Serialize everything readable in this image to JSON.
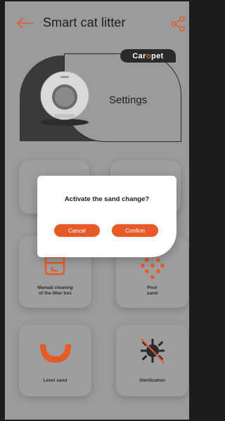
{
  "header": {
    "title": "Smart cat litter",
    "back_icon": "arrow-left-icon",
    "share_icon": "share-icon"
  },
  "hero": {
    "brand_prefix": "Car",
    "brand_o": "o",
    "brand_suffix": "pet",
    "settings_label": "Settings"
  },
  "tiles": [
    {
      "label_line1": "Manual cleaning",
      "label_line2": "of the litter box",
      "icon": "litter-box-icon"
    },
    {
      "label_line1": "Pour",
      "label_line2": "sand",
      "icon": "pour-sand-icon"
    },
    {
      "label_line1": "Level sand",
      "label_line2": "",
      "icon": "level-sand-icon"
    },
    {
      "label_line1": "Sterilization",
      "label_line2": "",
      "icon": "sterilization-icon"
    }
  ],
  "modal": {
    "title": "Activate the sand change?",
    "cancel_label": "Cancel",
    "confirm_label": "Confirm"
  },
  "colors": {
    "accent": "#e65a27",
    "overlay": "#9b9b9b",
    "dark": "#2a2a2a"
  }
}
